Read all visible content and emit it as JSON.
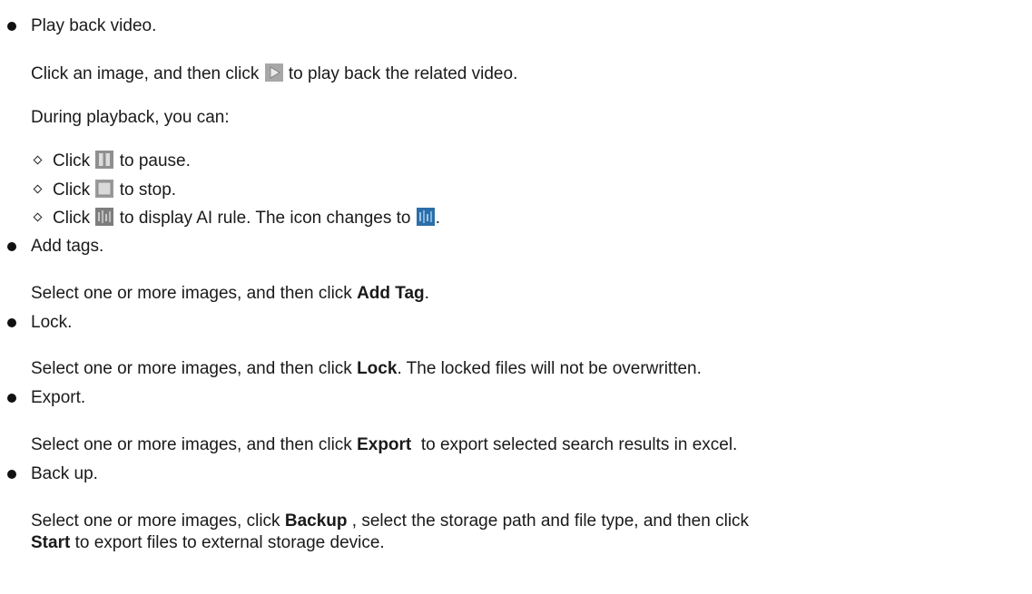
{
  "colors": {
    "play_icon_bg": "#a7a7a7",
    "pause_icon_bg": "#8f8f8f",
    "stop_icon_bg": "#9a9a9a",
    "ai_icon_off": "#7d7d7d",
    "ai_icon_on": "#2c6ea8"
  },
  "items": [
    {
      "heading": "Play back video.",
      "body_a": "Click an image, and then click",
      "body_a_icon": "play-icon",
      "body_b": "to play back the related video.",
      "sub_intro": "During playback, you can:",
      "subs": [
        {
          "pre": "Click",
          "icon": "pause-icon",
          "post": "to pause."
        },
        {
          "pre": "Click",
          "icon": "stop-icon",
          "post": "to stop."
        },
        {
          "pre": "Click",
          "icon": "ai-rule-off-icon",
          "post": "to display AI rule. The icon changes to",
          "icon2": "ai-rule-on-icon",
          "end": "."
        }
      ]
    },
    {
      "heading": "Add tags.",
      "body_pre": "Select one or more images, and then click",
      "body_bold": "Add Tag",
      "body_post": "."
    },
    {
      "heading": "Lock.",
      "body_pre": "Select one or more images, and then click",
      "body_bold": "Lock",
      "body_post": ". The locked files will not be overwritten."
    },
    {
      "heading": "Export.",
      "body_pre": "Select one or more images, and then click",
      "body_bold": "Export",
      "body_post": "to export selected search results in excel."
    },
    {
      "heading": "Back up.",
      "body_pre": "Select one or more images, click",
      "body_bold": "Backup",
      "body_post": ", select the storage path and file type, and then click",
      "body2_bold": "Start",
      "body2_post": "to export files to external storage device."
    }
  ]
}
